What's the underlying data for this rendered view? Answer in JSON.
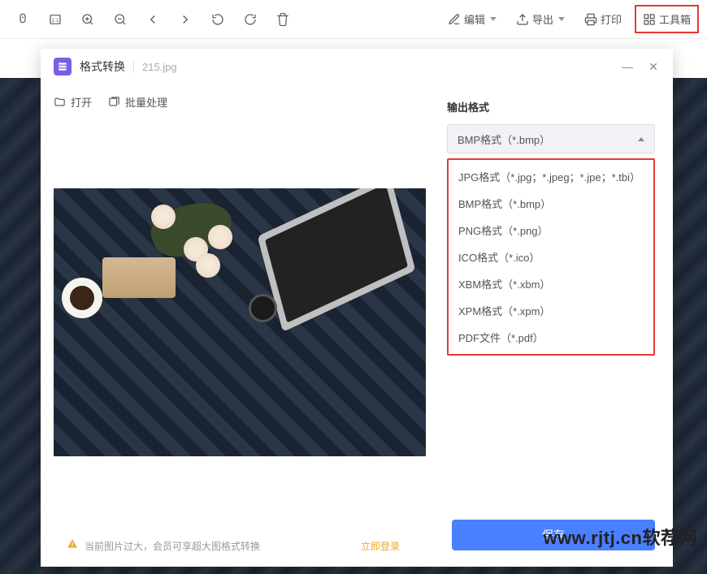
{
  "toolbar": {
    "edit_label": "编辑",
    "export_label": "导出",
    "print_label": "打印",
    "toolbox_label": "工具箱"
  },
  "modal": {
    "title": "格式转换",
    "filename": "215.jpg",
    "open_label": "打开",
    "batch_label": "批量处理",
    "minimize": "—",
    "close": "✕"
  },
  "output": {
    "label": "输出格式",
    "selected": "BMP格式（*.bmp）",
    "options": [
      "JPG格式（*.jpg；*.jpeg；*.jpe；*.tbi）",
      "BMP格式（*.bmp）",
      "PNG格式（*.png）",
      "ICO格式（*.ico）",
      "XBM格式（*.xbm）",
      "XPM格式（*.xpm）",
      "PDF文件（*.pdf）"
    ]
  },
  "footer": {
    "warning": "当前图片过大，会员可享超大图格式转换",
    "login": "立即登录",
    "save": "保存"
  },
  "watermark": "www.rjtj.cn软荐网"
}
